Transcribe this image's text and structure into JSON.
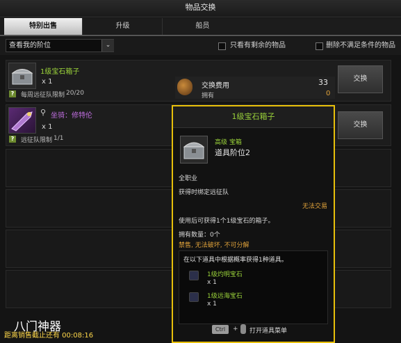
{
  "window": {
    "title": "物品交换"
  },
  "tabs": [
    {
      "label": "特别出售",
      "active": true
    },
    {
      "label": "升级",
      "active": false
    },
    {
      "label": "船员",
      "active": false
    }
  ],
  "filters": {
    "dropdown_value": "查看我的阶位",
    "only_remaining": "只看有剩余的物品",
    "remove_unmet": "删除不满足条件的物品"
  },
  "items": [
    {
      "name": "1级宝石箱子",
      "quantity": "x 1",
      "limit_label": "每周远征队限制",
      "limit_value": "20/20",
      "cost_label": "交换费用",
      "cost_value": "33",
      "owned_label": "拥有",
      "owned_value": "0",
      "button": "交换"
    },
    {
      "name": "坐骑：修特伦",
      "quantity": "x 1",
      "limit_label": "远征队限制",
      "limit_value": "1/1",
      "button": "交换"
    }
  ],
  "tooltip": {
    "title": "1级宝石箱子",
    "grade": "高级 宝箱",
    "tier": "道具阶位2",
    "class": "全职业",
    "bind": "获得时绑定远征队",
    "untradeable": "无法交易",
    "desc": "使用后可获得1个1级宝石的箱子。",
    "owned": "拥有数量：0个",
    "restrictions": "禁售, 无法破坏, 不可分解",
    "pool_intro": "在以下道具中根据概率获得1种道具。",
    "pool": [
      {
        "name": "1级灼明宝石",
        "qty": "x 1"
      },
      {
        "name": "1级远海宝石",
        "qty": "x 1"
      }
    ],
    "ctrl_key": "Ctrl",
    "open_menu": "打开道具菜单"
  },
  "footer": {
    "watermark": "八门神器",
    "timer": "距离销售截止还有 00:08:16"
  },
  "colors": {
    "accent": "#e8c00a",
    "item_green": "#9ad23a",
    "cost_orange": "#e0a23a"
  }
}
